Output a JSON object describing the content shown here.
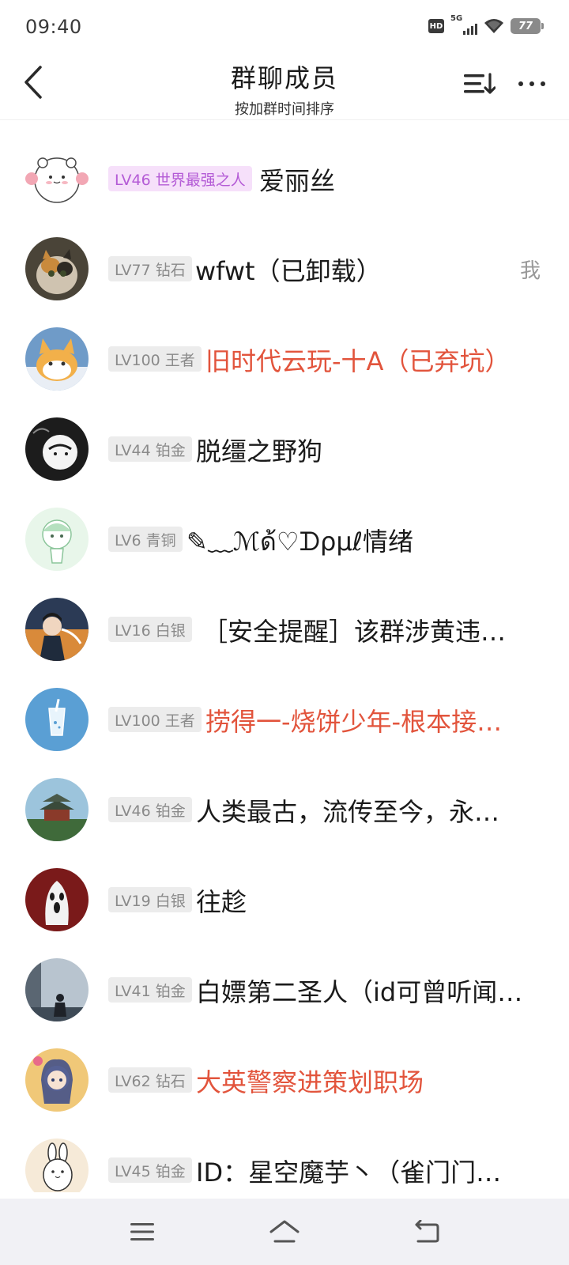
{
  "status_bar": {
    "time": "09:40",
    "hd_label": "HD",
    "network_label": "5G",
    "battery_level": "77",
    "icons": [
      "hd-icon",
      "signal-icon",
      "wifi-icon",
      "battery-icon"
    ]
  },
  "header": {
    "title": "群聊成员",
    "subtitle": "按加群时间排序",
    "icons": [
      "back-arrow-icon",
      "sort-icon",
      "more-icon"
    ]
  },
  "members": [
    {
      "level": "LV46 世界最强之人",
      "name": "爱丽丝",
      "badge_style": "special",
      "highlight": false,
      "me": false
    },
    {
      "level": "LV77 钻石",
      "name": "wfwt（已卸载）",
      "badge_style": "normal",
      "highlight": false,
      "me": true,
      "me_label": "我"
    },
    {
      "level": "LV100 王者",
      "name": "旧时代云玩-十A（已弃坑）",
      "badge_style": "normal",
      "highlight": true,
      "me": false
    },
    {
      "level": "LV44 铂金",
      "name": "脱缰之野狗",
      "badge_style": "normal",
      "highlight": false,
      "me": false
    },
    {
      "level": "LV6 青铜",
      "name": "✎﹏ℳด้♡ᗪρµℓ情绪",
      "badge_style": "normal",
      "highlight": false,
      "me": false
    },
    {
      "level": "LV16 白银",
      "name": "［安全提醒］该群涉黄违…",
      "badge_style": "normal",
      "highlight": false,
      "me": false
    },
    {
      "level": "LV100 王者",
      "name": "捞得一-烧饼少年-根本接…",
      "badge_style": "normal",
      "highlight": true,
      "me": false
    },
    {
      "level": "LV46 铂金",
      "name": "人类最古，流传至今，永…",
      "badge_style": "normal",
      "highlight": false,
      "me": false
    },
    {
      "level": "LV19 白银",
      "name": "往趁",
      "badge_style": "normal",
      "highlight": false,
      "me": false
    },
    {
      "level": "LV41 铂金",
      "name": "白嫖第二圣人（id可曾听闻…",
      "badge_style": "normal",
      "highlight": false,
      "me": false
    },
    {
      "level": "LV62 钻石",
      "name": "大英警察进策划职场",
      "badge_style": "normal",
      "highlight": true,
      "me": false
    },
    {
      "level": "LV45 铂金",
      "name": "ID：星空魔芋丶（雀门门…",
      "badge_style": "normal",
      "highlight": false,
      "me": false
    }
  ],
  "nav_bar": {
    "icons": [
      "menu-icon",
      "home-icon",
      "back-icon"
    ]
  },
  "colors": {
    "highlight_name": "#e2543c",
    "special_badge_bg": "#f6e0fa",
    "special_badge_text": "#b45bd6",
    "badge_bg": "#ececec",
    "badge_text": "#8a8a8a",
    "nav_bg": "#f1f1f5"
  }
}
